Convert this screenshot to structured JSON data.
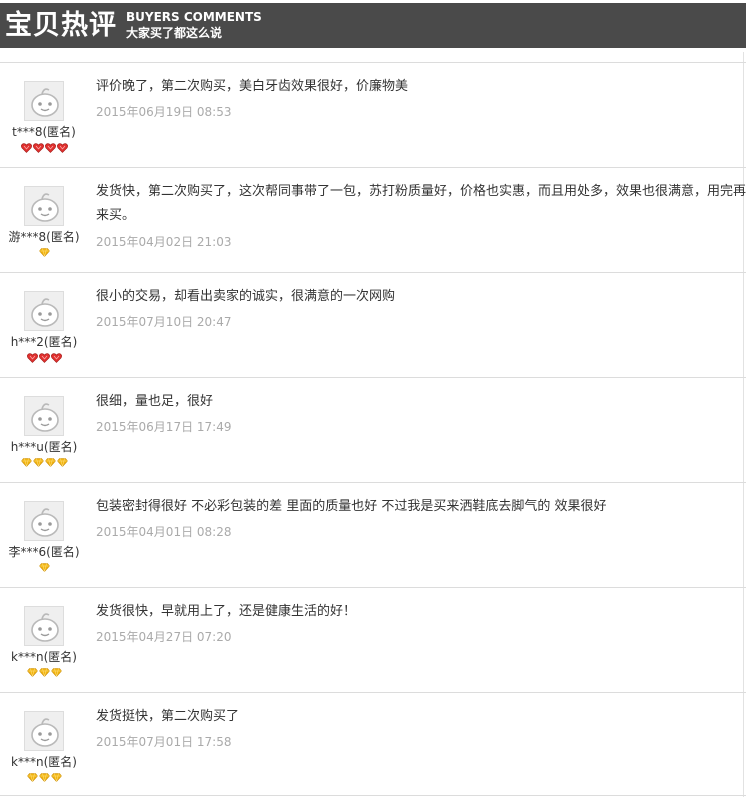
{
  "header": {
    "title": "宝贝热评",
    "subtitle_en": "BUYERS COMMENTS",
    "subtitle_cn": "大家买了都这么说"
  },
  "colors": {
    "header_bg": "#4a4a4a",
    "heart": "#e0302e",
    "diamond": "#f2b50f",
    "date_text": "#aaaaaa"
  },
  "comments": [
    {
      "text": "评价晚了，第二次购买，美白牙齿效果很好，价廉物美",
      "date": "2015年06月19日 08:53",
      "user": "t***8(匿名)",
      "rank_icon": "heart-icon",
      "rank_count": 4,
      "two_line": false
    },
    {
      "text": "发货快，第二次购买了，这次帮同事带了一包，苏打粉质量好，价格也实惠，而且用处多，效果也很满意，用完再来买。",
      "date": "2015年04月02日 21:03",
      "user": "游***8(匿名)",
      "rank_icon": "diamond-icon",
      "rank_count": 1,
      "two_line": true
    },
    {
      "text": "很小的交易，却看出卖家的诚实，很满意的一次网购",
      "date": "2015年07月10日 20:47",
      "user": "h***2(匿名)",
      "rank_icon": "heart-icon",
      "rank_count": 3,
      "two_line": false
    },
    {
      "text": "很细，量也足，很好",
      "date": "2015年06月17日 17:49",
      "user": "h***u(匿名)",
      "rank_icon": "diamond-icon",
      "rank_count": 4,
      "two_line": false
    },
    {
      "text": "包装密封得很好 不必彩包装的差 里面的质量也好 不过我是买来洒鞋底去脚气的 效果很好",
      "date": "2015年04月01日 08:28",
      "user": "李***6(匿名)",
      "rank_icon": "diamond-icon",
      "rank_count": 1,
      "two_line": false
    },
    {
      "text": "发货很快，早就用上了，还是健康生活的好！",
      "date": "2015年04月27日 07:20",
      "user": "k***n(匿名)",
      "rank_icon": "diamond-icon",
      "rank_count": 3,
      "two_line": false
    },
    {
      "text": "发货挺快，第二次购买了",
      "date": "2015年07月01日 17:58",
      "user": "k***n(匿名)",
      "rank_icon": "diamond-icon",
      "rank_count": 3,
      "two_line": false
    }
  ]
}
